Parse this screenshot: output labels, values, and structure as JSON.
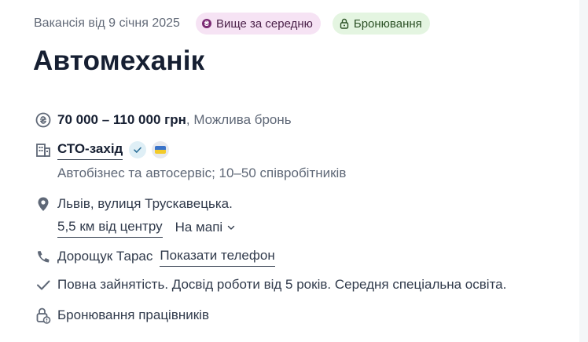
{
  "header": {
    "posted": "Вакансія від 9 січня 2025",
    "badge_salary": "Вище за середню",
    "badge_reserve": "Бронювання",
    "salary_badge_color": "#f6e3f4",
    "reserve_badge_color": "#e4f5e1"
  },
  "job": {
    "title": "Автомеханік"
  },
  "salary": {
    "range": "70 000 – 110 000 грн",
    "note": ", Можлива бронь"
  },
  "company": {
    "name": "СТО-захід",
    "description": "Автобізнес та автосервіс; 10–50 співробітників"
  },
  "location": {
    "address": "Львів, вулиця Трускавецька.",
    "distance": "5,5 км від центру",
    "map_label": "На мапі"
  },
  "contact": {
    "name": "Дорощук Тарас",
    "phone_link": "Показати телефон"
  },
  "conditions": {
    "text": "Повна зайнятість. Досвід роботи від 5 років. Середня спеціальна освіта."
  },
  "reservation": {
    "text": "Бронювання працівників"
  },
  "icons": {
    "salary": "hryvnia-icon",
    "company": "building-icon",
    "location": "map-pin-icon",
    "phone": "phone-icon",
    "conditions": "check-icon",
    "reservation": "lock-icon"
  }
}
